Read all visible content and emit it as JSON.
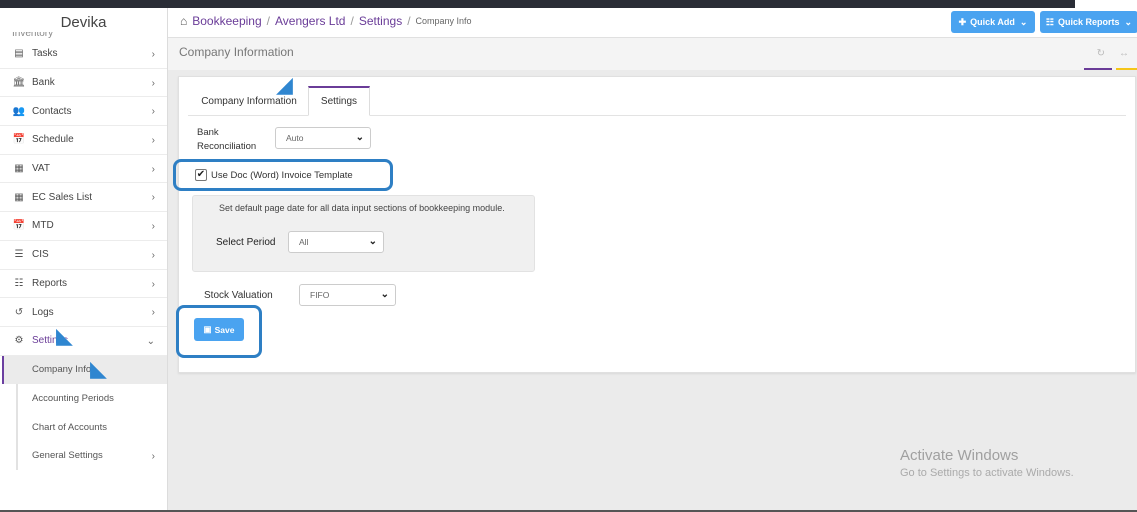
{
  "app": {
    "brand": "Devika"
  },
  "sidebar": {
    "cut_item": "Inventory",
    "items": [
      {
        "label": "Tasks",
        "icon": "tasks-icon",
        "glyph": "▤"
      },
      {
        "label": "Bank",
        "icon": "bank-icon",
        "glyph": "🏛"
      },
      {
        "label": "Contacts",
        "icon": "contacts-icon",
        "glyph": "👥"
      },
      {
        "label": "Schedule",
        "icon": "calendar-icon",
        "glyph": "📅"
      },
      {
        "label": "VAT",
        "icon": "calculator-icon",
        "glyph": "▦"
      },
      {
        "label": "EC Sales List",
        "icon": "calculator-icon",
        "glyph": "▦"
      },
      {
        "label": "MTD",
        "icon": "calendar-icon",
        "glyph": "📅"
      },
      {
        "label": "CIS",
        "icon": "list-icon",
        "glyph": "☰"
      },
      {
        "label": "Reports",
        "icon": "reports-icon",
        "glyph": "☷"
      },
      {
        "label": "Logs",
        "icon": "history-icon",
        "glyph": "↺"
      },
      {
        "label": "Settings",
        "icon": "gears-icon",
        "glyph": "⚙"
      }
    ],
    "sub_items": [
      {
        "label": "Company Info"
      },
      {
        "label": "Accounting Periods"
      },
      {
        "label": "Chart of Accounts"
      },
      {
        "label": "General Settings"
      }
    ]
  },
  "header": {
    "breadcrumb": [
      "Bookkeeping",
      "Avengers Ltd",
      "Settings"
    ],
    "breadcrumb_current": "Company Info",
    "quick_add": "Quick Add",
    "quick_reports": "Quick Reports"
  },
  "page": {
    "title": "Company Information"
  },
  "tabs": [
    "Company Information",
    "Settings"
  ],
  "form": {
    "bank_reconciliation_label_1": "Bank",
    "bank_reconciliation_label_2": "Reconciliation",
    "bank_reconciliation_value": "Auto",
    "use_doc_label": "Use Doc (Word) Invoice Template",
    "use_doc_checked": true,
    "period_description": "Set default page date for all data input sections of bookkeeping module.",
    "select_period_label": "Select Period",
    "select_period_value": "All",
    "stock_valuation_label": "Stock Valuation",
    "stock_valuation_value": "FIFO",
    "save_label": "Save"
  },
  "watermark": {
    "title": "Activate Windows",
    "subtitle": "Go to Settings to activate Windows."
  },
  "colors": {
    "accent": "#6a3c98",
    "button": "#4aa3f0",
    "highlight": "#2e7fc4"
  }
}
